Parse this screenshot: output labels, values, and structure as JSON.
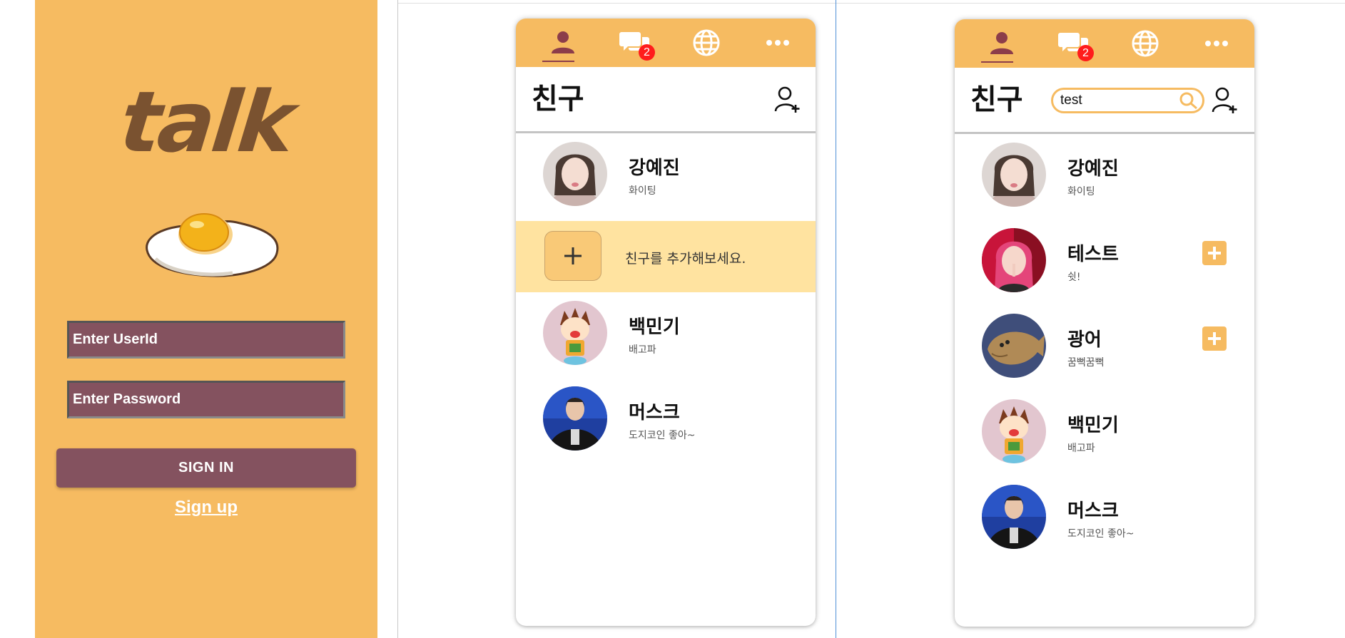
{
  "login": {
    "logo": "talk",
    "userid_placeholder": "Enter UserId",
    "password_placeholder": "Enter Password",
    "signin_label": "SIGN IN",
    "signup_label": "Sign up"
  },
  "tabs": [
    {
      "icon": "person-icon"
    },
    {
      "icon": "chat-icon",
      "badge": "2"
    },
    {
      "icon": "globe-icon"
    },
    {
      "icon": "more-icon"
    }
  ],
  "friends_screen": {
    "title": "친구",
    "add_friend_prompt": "친구를 추가해보세요.",
    "friends": [
      {
        "name": "강예진",
        "status": "화이팅"
      },
      {
        "name": "백민기",
        "status": "배고파"
      },
      {
        "name": "머스크",
        "status": "도지코인 좋아~"
      }
    ]
  },
  "search_screen": {
    "title": "친구",
    "search_value": "test",
    "friends": [
      {
        "name": "강예진",
        "status": "화이팅"
      },
      {
        "name": "테스트",
        "status": "쉿!"
      },
      {
        "name": "광어",
        "status": "꿈뻑꿈뻑"
      },
      {
        "name": "백민기",
        "status": "배고파"
      },
      {
        "name": "머스크",
        "status": "도지코인 좋아~"
      }
    ]
  },
  "colors": {
    "brand_orange": "#F6BB61",
    "brand_plum": "#84525F",
    "badge_red": "#FF1C1C",
    "highlight_yellow": "#FFE3A0"
  }
}
